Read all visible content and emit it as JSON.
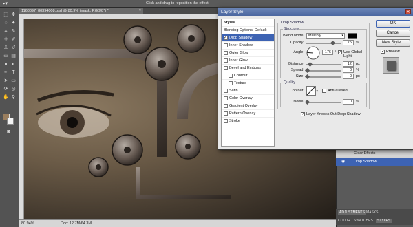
{
  "options_bar": {
    "hint": "Click and drag to reposition the effect.",
    "tool_icon": "move-arrow-icon"
  },
  "document": {
    "tab_title": "1168097_80394008.psd @ 80.9% (mask, RGB/8*) *",
    "close_glyph": "×",
    "zoom": "80.94%",
    "doc_info": "Doc: 12.7M/64.3M"
  },
  "tools": {
    "foreground_color": "#9a7e5e",
    "background_color": "#f3f3f3"
  },
  "dialog": {
    "title": "Layer Style",
    "close_glyph": "✕",
    "styles_header": "Styles",
    "style_items": [
      {
        "label": "Blending Options: Default",
        "kind": "header",
        "checked": false
      },
      {
        "label": "Drop Shadow",
        "kind": "effect",
        "checked": true,
        "selected": true
      },
      {
        "label": "Inner Shadow",
        "kind": "effect",
        "checked": false
      },
      {
        "label": "Outer Glow",
        "kind": "effect",
        "checked": false
      },
      {
        "label": "Inner Glow",
        "kind": "effect",
        "checked": false
      },
      {
        "label": "Bevel and Emboss",
        "kind": "effect",
        "checked": false
      },
      {
        "label": "Contour",
        "kind": "sub",
        "checked": false
      },
      {
        "label": "Texture",
        "kind": "sub",
        "checked": false
      },
      {
        "label": "Satin",
        "kind": "effect",
        "checked": false
      },
      {
        "label": "Color Overlay",
        "kind": "effect",
        "checked": false
      },
      {
        "label": "Gradient Overlay",
        "kind": "effect",
        "checked": false
      },
      {
        "label": "Pattern Overlay",
        "kind": "effect",
        "checked": false
      },
      {
        "label": "Stroke",
        "kind": "effect",
        "checked": false
      }
    ],
    "drop_shadow": {
      "section_title": "Drop Shadow",
      "structure_title": "Structure",
      "blend_mode_label": "Blend Mode:",
      "blend_mode_value": "Multiply",
      "shadow_color": "#000000",
      "opacity_label": "Opacity:",
      "opacity_value": "75",
      "opacity_unit": "%",
      "angle_label": "Angle:",
      "angle_value": "176",
      "angle_unit": "°",
      "use_global_light_label": "Use Global Light",
      "use_global_light": true,
      "distance_label": "Distance:",
      "distance_value": "12",
      "distance_unit": "px",
      "spread_label": "Spread:",
      "spread_value": "0",
      "spread_unit": "%",
      "size_label": "Size:",
      "size_value": "0",
      "size_unit": "px",
      "quality_title": "Quality",
      "contour_label": "Contour:",
      "anti_aliased_label": "Anti-aliased",
      "anti_aliased": false,
      "noise_label": "Noise:",
      "noise_value": "0",
      "noise_unit": "%",
      "knocks_out_label": "Layer Knocks Out Drop Shadow",
      "knocks_out": true
    },
    "buttons": {
      "ok": "OK",
      "cancel": "Cancel",
      "new_style": "New Style...",
      "preview_label": "Preview",
      "preview_checked": true
    }
  },
  "layers": {
    "rows": [
      {
        "label": "Clear Effects",
        "selected": false
      },
      {
        "label": "Drop Shadow",
        "selected": true
      }
    ]
  },
  "panel_tabs": {
    "adjustments": "ADJUSTMENTS",
    "masks": "MASKS",
    "color": "COLOR",
    "swatches": "SWATCHES",
    "styles": "STYLES"
  },
  "colors": {
    "selection_blue": "#3d63b3",
    "canvas_sepia": "#6b5b47"
  }
}
